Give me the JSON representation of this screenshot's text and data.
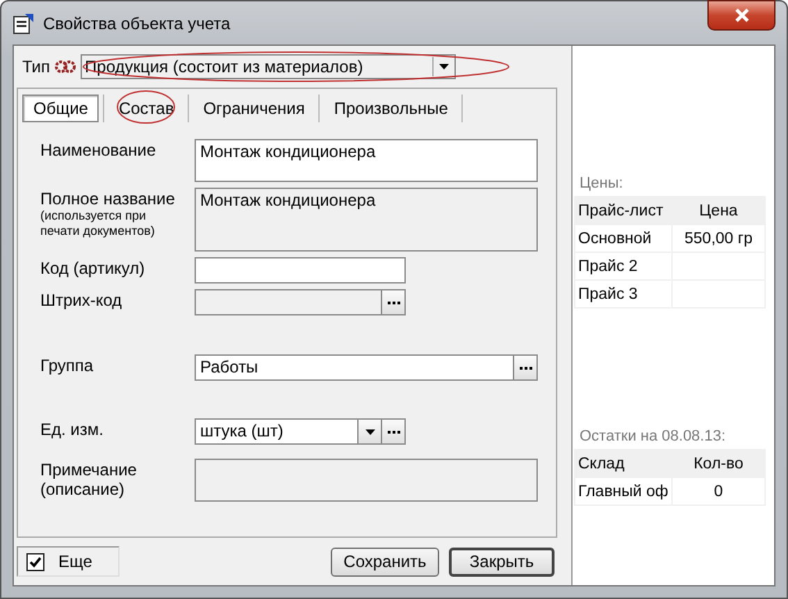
{
  "window": {
    "title": "Свойства объекта учета"
  },
  "type_field": {
    "label": "Тип",
    "value": "Продукция (состоит из материалов)"
  },
  "tabs": [
    {
      "label": "Общие",
      "selected": true
    },
    {
      "label": "Состав",
      "selected": false
    },
    {
      "label": "Ограничения",
      "selected": false
    },
    {
      "label": "Произвольные",
      "selected": false
    }
  ],
  "fields": [
    {
      "kind": "multiline",
      "label": "Наименование",
      "value": "Монтаж кондиционера",
      "disabled": false
    },
    {
      "kind": "multiline",
      "label": "Полное название",
      "note": "(используется при печати документов)",
      "value": "Монтаж кондиционера",
      "disabled": true
    },
    {
      "kind": "text",
      "label": "Код (артикул)",
      "disabled": false
    },
    {
      "kind": "picker",
      "label": "Штрих-код",
      "disabled": true
    },
    {
      "kind": "picker",
      "label": "Группа",
      "value": "Работы",
      "disabled": false
    },
    {
      "kind": "dropdown",
      "label": "Ед. изм.",
      "value": "штука (шт)",
      "disabled": false
    },
    {
      "kind": "multiline",
      "label": "Примечание (описание)",
      "disabled": true
    }
  ],
  "more_checkbox": {
    "label": "Еще",
    "checked": true
  },
  "buttons": [
    "Сохранить",
    "Закрыть"
  ],
  "prices": {
    "title": "Цены:",
    "columns": [
      "Прайс-лист",
      "Цена"
    ],
    "rows": [
      [
        "Основной",
        "550,00 гр"
      ],
      [
        "Прайс 2",
        ""
      ],
      [
        "Прайс 3",
        ""
      ]
    ]
  },
  "stock": {
    "title": "Остатки на 08.08.13:",
    "columns": [
      "Склад",
      "Кол-во"
    ],
    "rows": [
      [
        "Главный оф",
        "0"
      ]
    ]
  }
}
